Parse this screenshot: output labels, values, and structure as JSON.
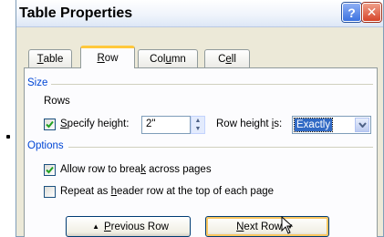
{
  "dialog": {
    "title": "Table Properties",
    "help_label": "?",
    "close_label": "✕"
  },
  "tabs": [
    {
      "pre": "",
      "key": "T",
      "post": "able",
      "active": false
    },
    {
      "pre": "",
      "key": "R",
      "post": "ow",
      "active": true
    },
    {
      "pre": "Col",
      "key": "u",
      "post": "mn",
      "active": false
    },
    {
      "pre": "C",
      "key": "e",
      "post": "ll",
      "active": false
    }
  ],
  "size": {
    "section_label": "Size",
    "rows_label": "Rows",
    "specify_height": {
      "pre": "",
      "key": "S",
      "post": "pecify height:",
      "checked": true
    },
    "height_value": "2\"",
    "row_height_is": {
      "pre": "Row height ",
      "key": "i",
      "post": "s:"
    },
    "row_height_select_value": "Exactly"
  },
  "options": {
    "section_label": "Options",
    "allow_break": {
      "pre": "Allow row to brea",
      "key": "k",
      "post": " across pages",
      "checked": true
    },
    "repeat_header": {
      "pre": "Repeat as ",
      "key": "h",
      "post": "eader row at the top of each page",
      "checked": false
    }
  },
  "buttons": {
    "previous_row": {
      "glyph": "▲",
      "pre": "",
      "key": "P",
      "post": "revious Row"
    },
    "next_row": {
      "glyph": "▼",
      "pre": "",
      "key": "N",
      "post": "ext Row"
    }
  },
  "colors": {
    "accent_section_text": "#0046d5",
    "active_tab_highlight": "#ffc83c",
    "dialog_face": "#ece9d8",
    "selection": "#316ac5"
  }
}
